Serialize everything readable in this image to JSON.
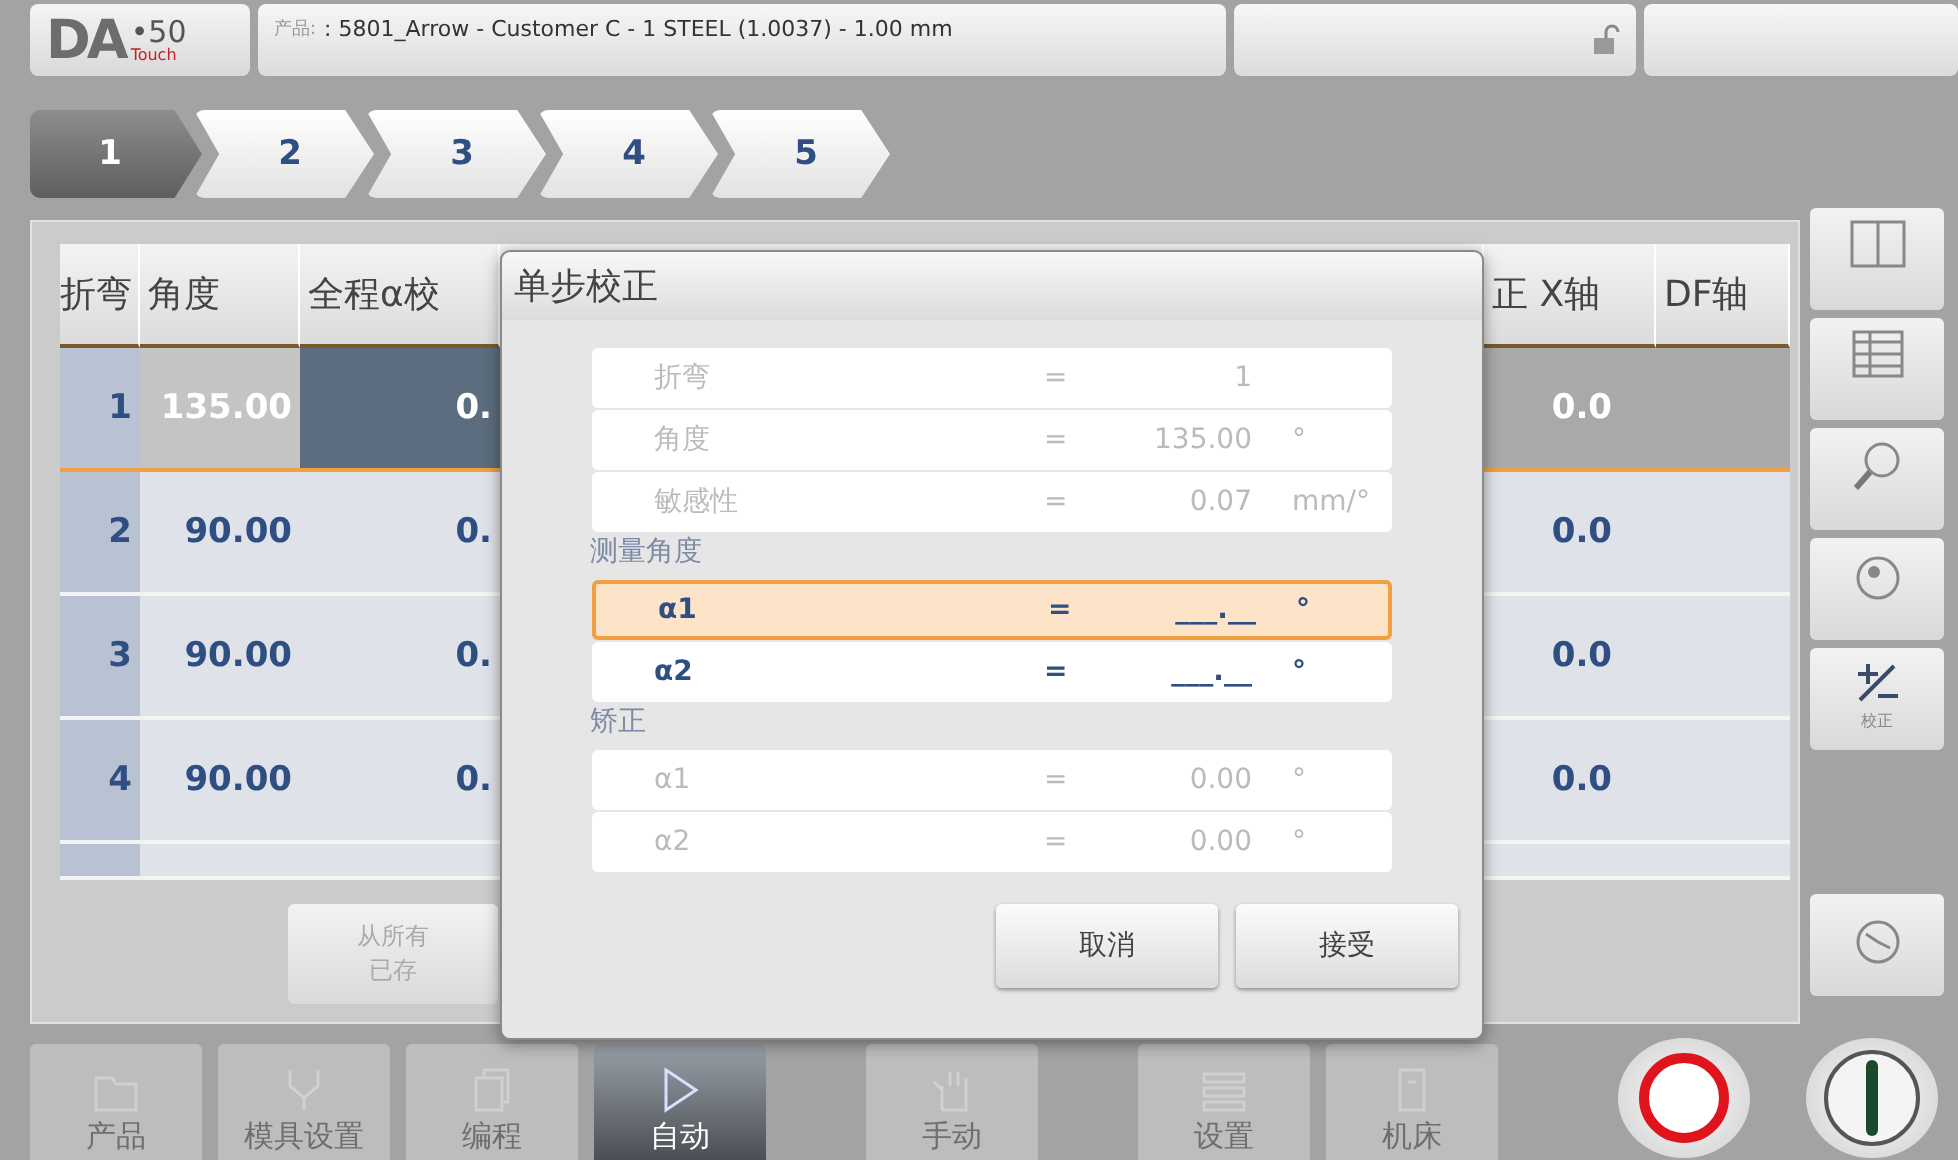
{
  "header": {
    "brand": "DA",
    "model": "•50",
    "edition": "Touch",
    "product_label": "产品:",
    "product": ": 5801_Arrow - Customer C - 1 STEEL (1.0037) - 1.00 mm"
  },
  "steps": [
    {
      "label": "1",
      "selected": true
    },
    {
      "label": "2",
      "selected": false
    },
    {
      "label": "3",
      "selected": false
    },
    {
      "label": "4",
      "selected": false
    },
    {
      "label": "5",
      "selected": false
    }
  ],
  "table": {
    "columns": [
      "折弯",
      "角度",
      "全程α校",
      "正 X轴",
      "DF轴"
    ],
    "rows": [
      {
        "bend": "1",
        "angle": "135.00",
        "column_3": "0.",
        "column_4": "0.0",
        "selected": true
      },
      {
        "bend": "2",
        "angle": "90.00",
        "column_3": "0.",
        "column_4": "0.0",
        "selected": false
      },
      {
        "bend": "3",
        "angle": "90.00",
        "column_3": "0.",
        "column_4": "0.0",
        "selected": false
      },
      {
        "bend": "4",
        "angle": "90.00",
        "column_3": "0.",
        "column_4": "0.0",
        "selected": false
      }
    ]
  },
  "copy_button": {
    "lines": [
      "从所有",
      "已存"
    ]
  },
  "dialog": {
    "title": "单步校正",
    "info": [
      {
        "label": "折弯",
        "sign": "=",
        "value": "1"
      },
      {
        "label": "角度",
        "sign": "=",
        "value": "135.00",
        "unit": "°"
      },
      {
        "label": "敏感性",
        "sign": "=",
        "value": "0.07",
        "unit": "mm/°"
      }
    ],
    "sections": [
      {
        "title": "测量角度",
        "rows": [
          {
            "label": "α1",
            "sign": "=",
            "value": "___.__",
            "unit": "°",
            "editable": true,
            "selected": true
          },
          {
            "label": "α2",
            "sign": "=",
            "value": "___.__",
            "unit": "°",
            "editable": true,
            "selected": false
          }
        ]
      },
      {
        "title": "矫正",
        "rows": [
          {
            "label": "α1",
            "sign": "=",
            "value": "0.00",
            "unit": "°",
            "editable": false,
            "selected": false
          },
          {
            "label": "α2",
            "sign": "=",
            "value": "0.00",
            "unit": "°",
            "editable": false,
            "selected": false
          }
        ]
      }
    ],
    "buttons": [
      "取消",
      "接受"
    ]
  },
  "side_tools": [
    {
      "kind": "split"
    },
    {
      "kind": "table"
    },
    {
      "kind": "zoom"
    },
    {
      "kind": "camera"
    },
    {
      "kind": "correct",
      "label": "校正"
    }
  ],
  "side_bottom": {
    "kind": "clock"
  },
  "nav": [
    {
      "label": "产品",
      "kind": "folder",
      "selected": false
    },
    {
      "label": "模具设置",
      "kind": "tools",
      "selected": false
    },
    {
      "label": "编程",
      "kind": "pages",
      "selected": false
    },
    {
      "label": "自动",
      "kind": "play",
      "selected": true
    },
    {
      "label": "手动",
      "kind": "hand",
      "selected": false
    },
    {
      "label": "设置",
      "kind": "settings",
      "selected": false
    },
    {
      "label": "机床",
      "kind": "machine",
      "selected": false
    }
  ]
}
